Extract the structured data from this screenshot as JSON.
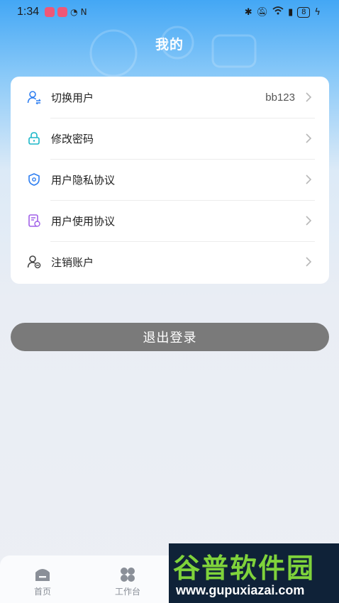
{
  "status_bar": {
    "time": "1:34",
    "battery": "8"
  },
  "page": {
    "title": "我的"
  },
  "menu": {
    "items": [
      {
        "label": "切换用户",
        "value": "bb123",
        "icon": "user-switch-icon"
      },
      {
        "label": "修改密码",
        "value": "",
        "icon": "lock-icon"
      },
      {
        "label": "用户隐私协议",
        "value": "",
        "icon": "shield-icon"
      },
      {
        "label": "用户使用协议",
        "value": "",
        "icon": "document-icon"
      },
      {
        "label": "注销账户",
        "value": "",
        "icon": "user-remove-icon"
      }
    ]
  },
  "logout_label": "退出登录",
  "tabbar": {
    "tabs": [
      {
        "label": "首页",
        "icon": "home-icon"
      },
      {
        "label": "工作台",
        "icon": "grid-icon"
      }
    ]
  },
  "watermark": {
    "title": "谷普软件园",
    "url": "www.gupuxiazai.com"
  },
  "colors": {
    "header_blue": "#43a7f5",
    "logout_bg": "#7a7a7a",
    "icon_blue": "#2f7ff1",
    "watermark_green": "#7fd33b"
  }
}
